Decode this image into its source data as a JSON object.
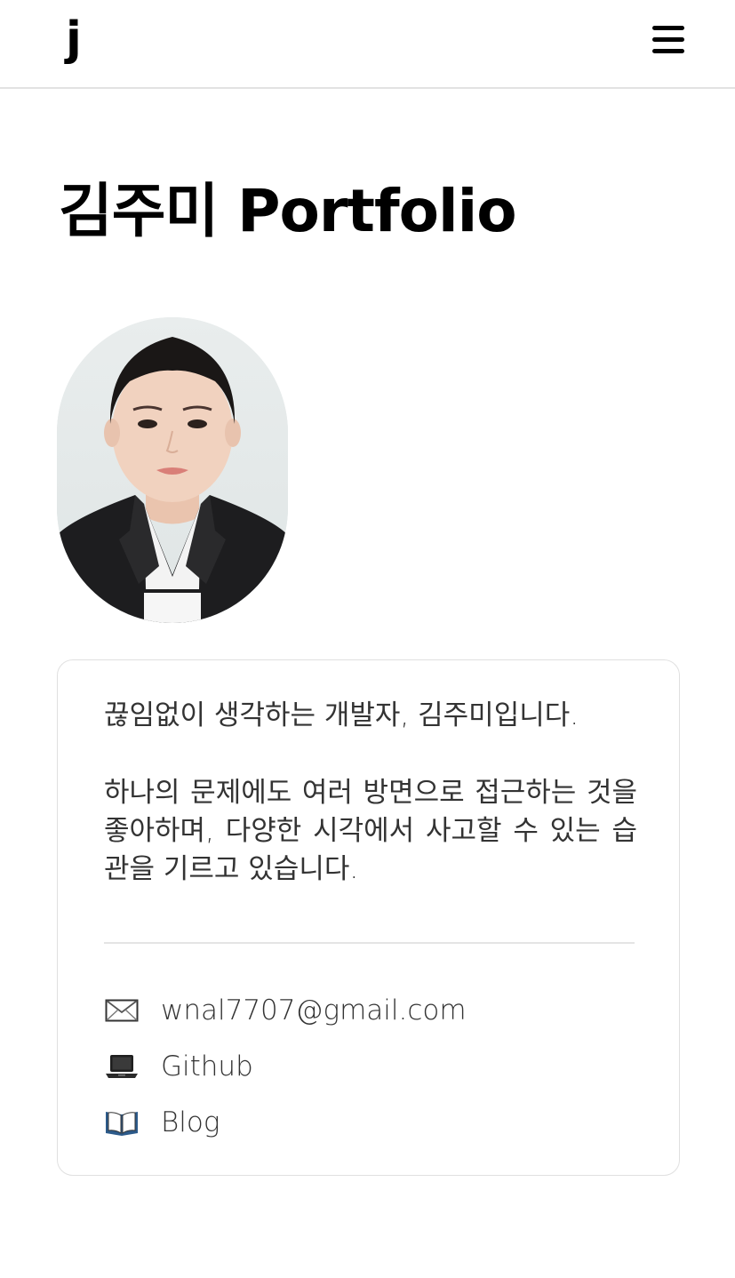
{
  "header": {
    "logo": "j",
    "menu_icon": "hamburger-menu-icon"
  },
  "main": {
    "title": "김주미 Portfolio",
    "profile_alt": "profile photo"
  },
  "card": {
    "intro": "끊임없이 생각하는 개발자, 김주미입니다.",
    "description": "하나의 문제에도 여러 방면으로 접근하는 것을 좋아하며, 다양한 시각에서 사고할 수 있는 습관을 기르고 있습니다.",
    "contacts": [
      {
        "icon": "envelope-icon",
        "label": "wnal7707@gmail.com"
      },
      {
        "icon": "laptop-icon",
        "label": "Github"
      },
      {
        "icon": "open-book-icon",
        "label": "Blog"
      }
    ]
  },
  "colors": {
    "text": "#333333",
    "title": "#000000",
    "border": "#e0e0e0",
    "photo_bg": "#e2e8e8"
  }
}
